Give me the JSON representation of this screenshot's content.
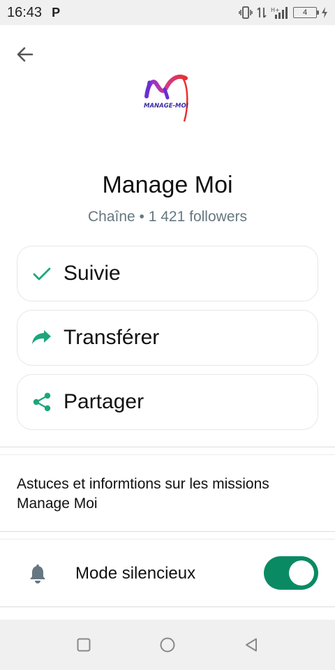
{
  "status_bar": {
    "time": "16:43",
    "carrier_icon_text": "P",
    "battery_level": "4",
    "icons": [
      "vibrate-icon",
      "data-arrows-icon",
      "signal-icon",
      "battery-icon",
      "charging-icon"
    ]
  },
  "header": {
    "back_icon": "arrow-left-icon"
  },
  "channel": {
    "logo_text": "MANAGE-MOI",
    "name": "Manage Moi",
    "subtitle": "Chaîne • 1 421 followers"
  },
  "actions": [
    {
      "label": "Suivie",
      "icon": "check-icon"
    },
    {
      "label": "Transférer",
      "icon": "forward-arrow-icon"
    },
    {
      "label": "Partager",
      "icon": "share-icon"
    }
  ],
  "description": "Astuces et informtions sur les missions Manage Moi",
  "mute": {
    "label": "Mode silencieux",
    "enabled": true,
    "icon": "bell-icon"
  },
  "navigation": {
    "buttons": [
      "recents-square-icon",
      "home-circle-icon",
      "back-triangle-icon"
    ]
  },
  "colors": {
    "accent": "#0a8a63",
    "icon_green": "#1da67b",
    "subtle_text": "#667781"
  }
}
